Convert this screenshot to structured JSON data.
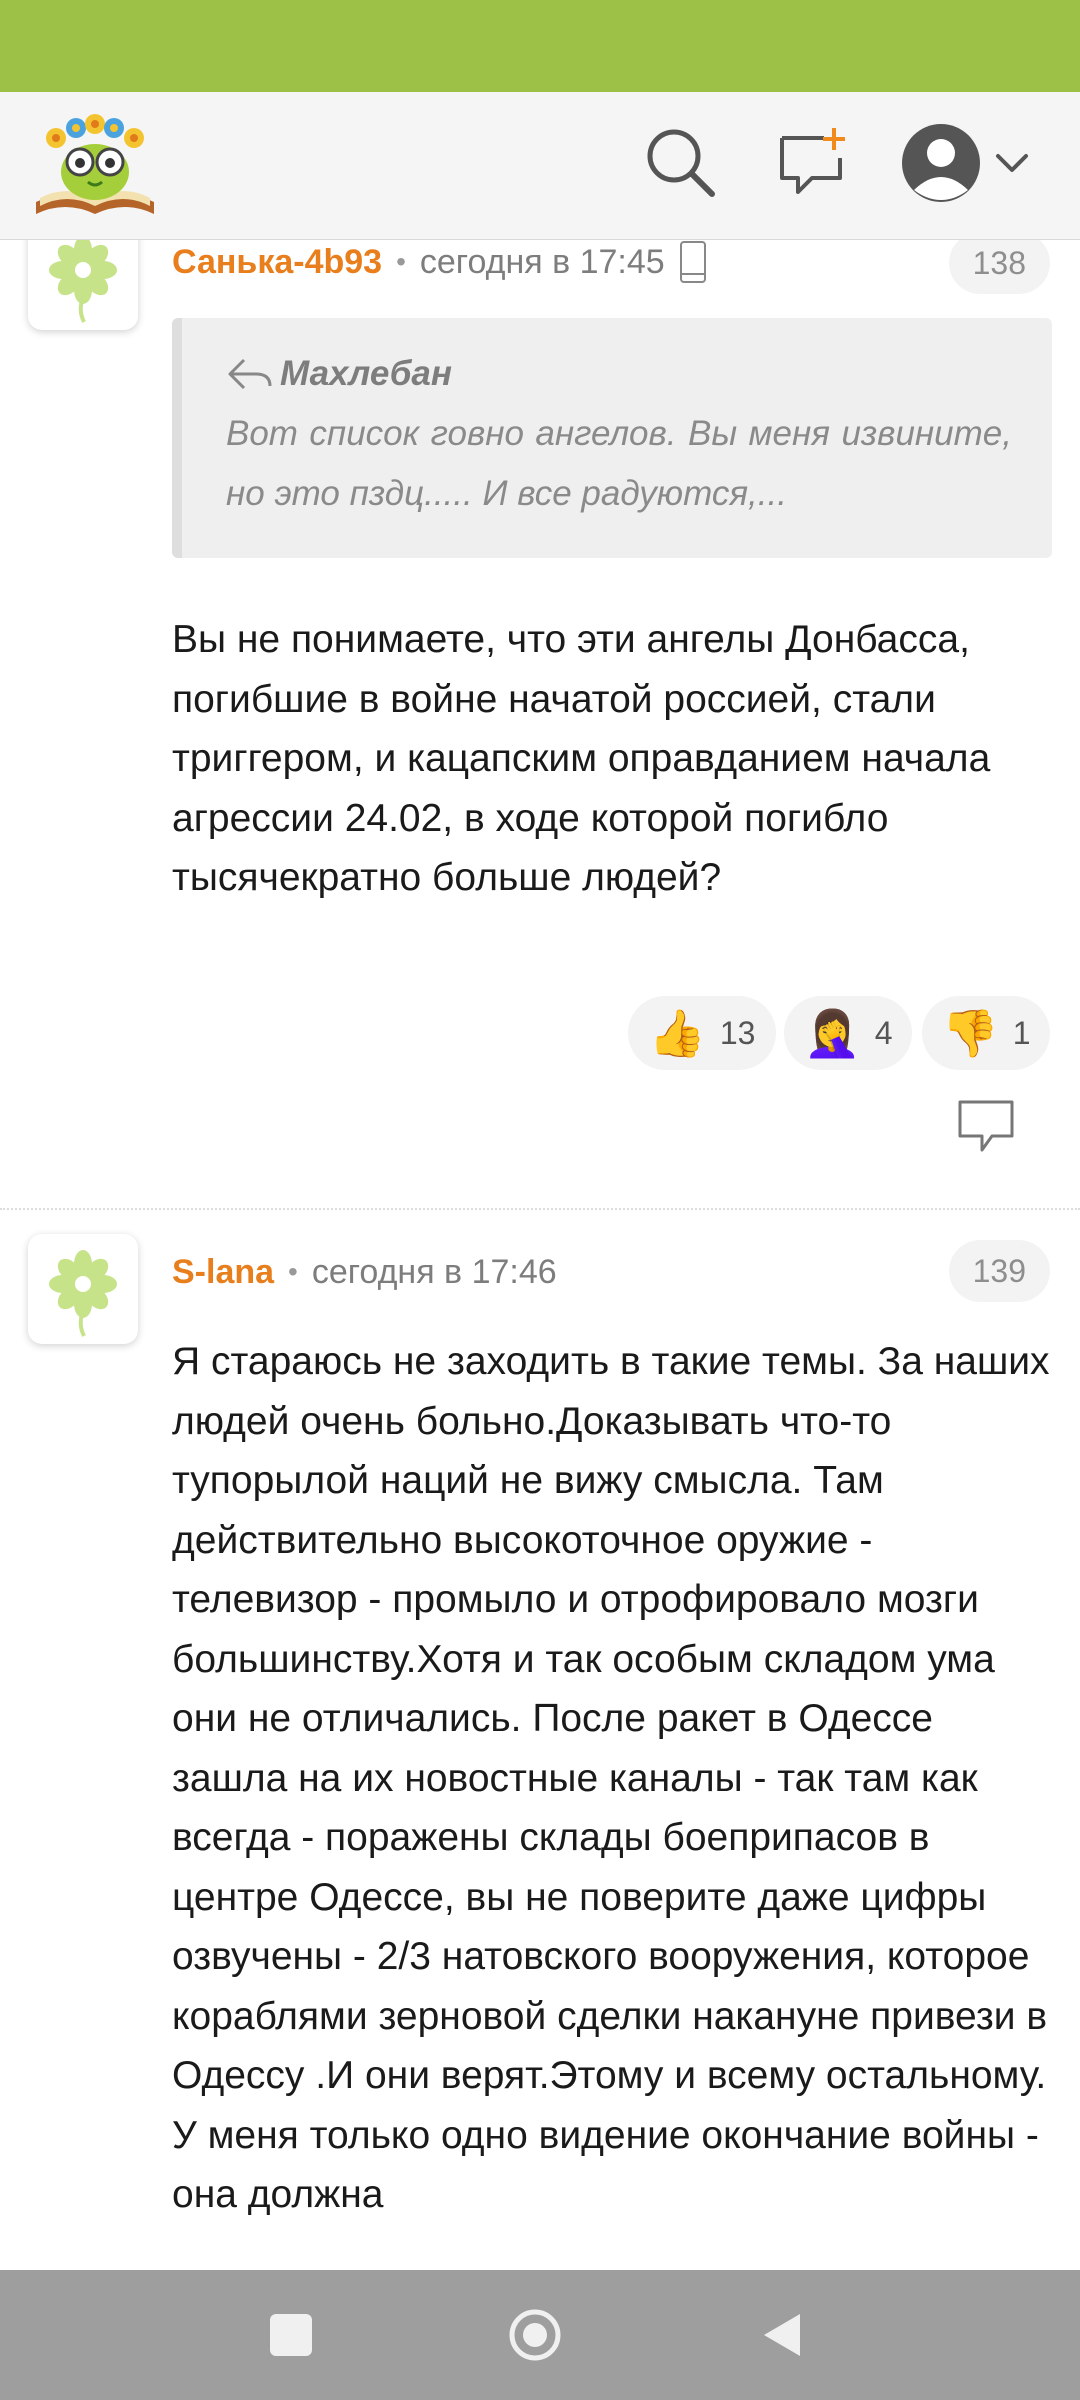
{
  "header": {
    "logo_icon": "flower-book-owl-logo",
    "search_icon": "search-icon",
    "new_post_icon": "new-message-icon",
    "profile_icon": "profile-avatar-icon",
    "menu_icon": "chevron-down-icon"
  },
  "comments": [
    {
      "author": "Санька-4b93",
      "time": "сегодня в 17:45",
      "device_icon": "mobile-phone-icon",
      "number": "138",
      "quote": {
        "author": "Махлебан",
        "reply_icon": "reply-arrow-icon",
        "text": "Вот список говно ангелов. Вы меня извините, но это пздц..... И все радуются,..."
      },
      "text": "Вы не понимаете, что эти ангелы Донбасса, погибшие в войне начатой россией, стали триггером, и кацапским оправданием начала агрессии 24.02, в ходе которой погибло тысячекратно больше людей?",
      "reactions": [
        {
          "emoji": "👍",
          "count": "13",
          "icon": "thumbs-up-icon"
        },
        {
          "emoji": "🤦‍♀️",
          "count": "4",
          "icon": "facepalm-icon"
        },
        {
          "emoji": "👎",
          "count": "1",
          "icon": "thumbs-down-icon"
        }
      ],
      "reply_icon": "reply-comment-icon"
    },
    {
      "author": "S-lana",
      "time": "сегодня в 17:46",
      "number": "139",
      "text": "Я стараюсь не заходить в такие темы. За наших людей очень больно.Доказывать что-то тупорылой наций не вижу смысла. Там действительно высокоточное оружие - телевизор - промыло и отрофировало мозги большинству.Хотя и так особым складом ума они не отличались. После ракет в Одессе зашла на их новостные каналы - так там как всегда - поражены склады боеприпасов в центре Одессе, вы не поверите даже цифры озвучены - 2/3 натовского вооружения, которое кораблями зерновой сделки накануне привези в Одессу .И они верят.Этому и всему остальному. У меня только одно видение окончание войны - она должна"
    }
  ],
  "navbar": {
    "recents_icon": "square-recents-icon",
    "home_icon": "circle-home-icon",
    "back_icon": "triangle-back-icon"
  },
  "colors": {
    "status_bar": "#9dc147",
    "author": "#e87e1c",
    "navbar": "#9e9e9e"
  }
}
